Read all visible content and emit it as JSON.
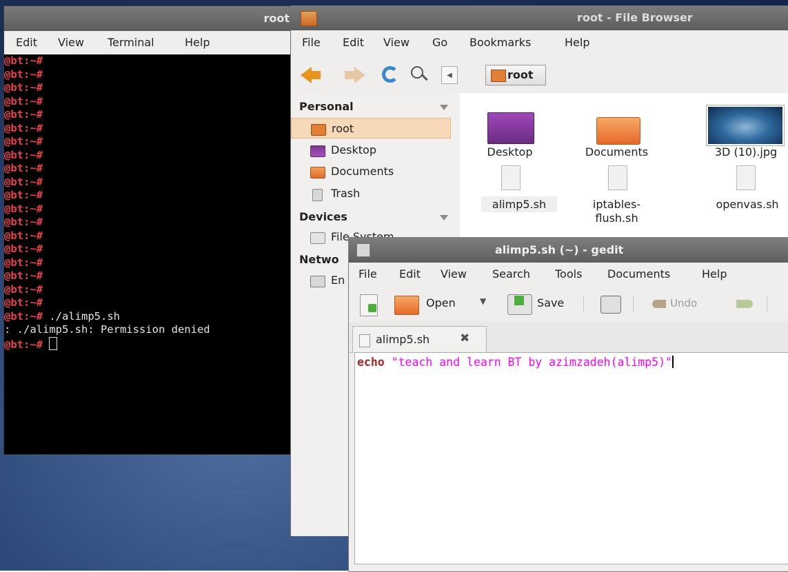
{
  "terminal": {
    "title": "root",
    "menu": [
      "Edit",
      "View",
      "Terminal",
      "Help"
    ],
    "prompt": "@bt",
    "prompt_rest": ":~#",
    "empty_prompt_count": 19,
    "command": " ./alimp5.sh",
    "error": ": ./alimp5.sh: Permission denied"
  },
  "file_browser": {
    "title": "root - File Browser",
    "menu": [
      "File",
      "Edit",
      "View",
      "Go",
      "Bookmarks",
      "Help"
    ],
    "path_button": "root",
    "sidebar": {
      "personal_label": "Personal",
      "personal_items": [
        "root",
        "Desktop",
        "Documents",
        "Trash"
      ],
      "devices_label": "Devices",
      "devices_items": [
        "File System"
      ],
      "network_label": "Netwo",
      "network_items": [
        "En"
      ]
    },
    "files": [
      "Desktop",
      "Documents",
      "3D (10).jpg",
      "alimp5.sh",
      "iptables-",
      "flush.sh",
      "openvas.sh"
    ]
  },
  "gedit": {
    "title": "alimp5.sh (~) - gedit",
    "menu": [
      "File",
      "Edit",
      "View",
      "Search",
      "Tools",
      "Documents",
      "Help"
    ],
    "toolbar": {
      "open": "Open",
      "save": "Save",
      "undo": "Undo"
    },
    "tab_label": "alimp5.sh",
    "code_keyword": "echo",
    "code_string": " \"teach and learn BT by azimzadeh(alimp5)\""
  },
  "colors": {
    "terminal_prompt": "#e8424a",
    "folder": "#e07f35",
    "keyword": "#a52a2a",
    "string": "#ff00ff",
    "selection": "#f6d9b8"
  }
}
